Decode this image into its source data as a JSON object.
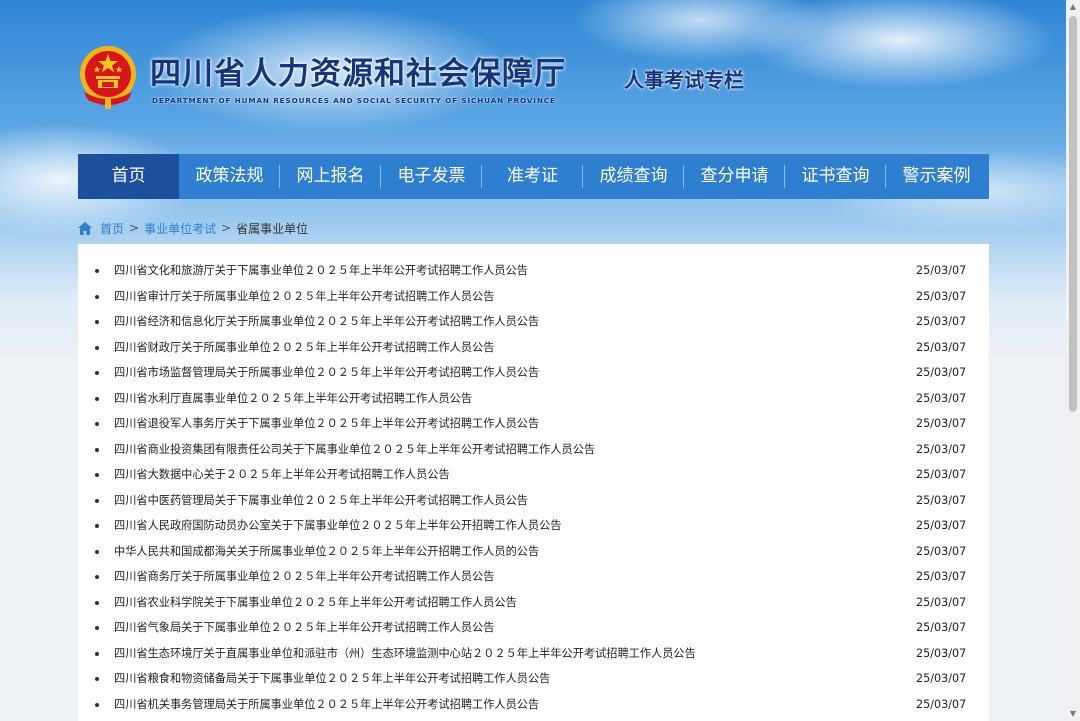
{
  "header": {
    "site_title": "四川省人力资源和社会保障厅",
    "site_subtitle": "DEPARTMENT OF HUMAN RESOURCES AND SOCIAL SECURITY OF SICHUAN PROVINCE",
    "column_name": "人事考试专栏",
    "emblem_icon": "national-emblem-icon"
  },
  "nav": {
    "items": [
      {
        "label": "首页",
        "active": true
      },
      {
        "label": "政策法规"
      },
      {
        "label": "网上报名"
      },
      {
        "label": "电子发票"
      },
      {
        "label": "准考证"
      },
      {
        "label": "成绩查询"
      },
      {
        "label": "查分申请"
      },
      {
        "label": "证书查询"
      },
      {
        "label": "警示案例"
      }
    ],
    "color": "#2f7fd1",
    "active_color": "#1c4f9c"
  },
  "breadcrumb": {
    "icon": "home-icon",
    "home": "首页",
    "section": "事业单位考试",
    "current": "省属事业单位",
    "separator": ">"
  },
  "news": [
    {
      "title": "四川省文化和旅游厅关于下属事业单位２０２５年上半年公开考试招聘工作人员公告",
      "date": "25/03/07"
    },
    {
      "title": "四川省审计厅关于所属事业单位２０２５年上半年公开考试招聘工作人员公告",
      "date": "25/03/07"
    },
    {
      "title": "四川省经济和信息化厅关于所属事业单位２０２５年上半年公开考试招聘工作人员公告",
      "date": "25/03/07"
    },
    {
      "title": "四川省财政厅关于所属事业单位２０２５年上半年公开考试招聘工作人员公告",
      "date": "25/03/07"
    },
    {
      "title": "四川省市场监督管理局关于所属事业单位２０２５年上半年公开考试招聘工作人员公告",
      "date": "25/03/07"
    },
    {
      "title": "四川省水利厅直属事业单位２０２５年上半年公开考试招聘工作人员公告",
      "date": "25/03/07"
    },
    {
      "title": "四川省退役军人事务厅关于下属事业单位２０２５年上半年公开考试招聘工作人员公告",
      "date": "25/03/07"
    },
    {
      "title": "四川省商业投资集团有限责任公司关于下属事业单位２０２５年上半年公开考试招聘工作人员公告",
      "date": "25/03/07"
    },
    {
      "title": "四川省大数据中心关于２０２５年上半年公开考试招聘工作人员公告",
      "date": "25/03/07"
    },
    {
      "title": "四川省中医药管理局关于下属事业单位２０２５年上半年公开考试招聘工作人员公告",
      "date": "25/03/07"
    },
    {
      "title": "四川省人民政府国防动员办公室关于下属事业单位２０２５年上半年公开招聘工作人员公告",
      "date": "25/03/07"
    },
    {
      "title": "中华人民共和国成都海关关于所属事业单位２０２５年上半年公开招聘工作人员的公告",
      "date": "25/03/07"
    },
    {
      "title": "四川省商务厅关于所属事业单位２０２５年上半年公开考试招聘工作人员公告",
      "date": "25/03/07"
    },
    {
      "title": "四川省农业科学院关于下属事业单位２０２５年上半年公开考试招聘工作人员公告",
      "date": "25/03/07"
    },
    {
      "title": "四川省气象局关于下属事业单位２０２５年上半年公开考试招聘工作人员公告",
      "date": "25/03/07"
    },
    {
      "title": "四川省生态环境厅关于直属事业单位和派驻市（州）生态环境监测中心站２０２５年上半年公开考试招聘工作人员公告",
      "date": "25/03/07"
    },
    {
      "title": "四川省粮食和物资储备局关于下属事业单位２０２５年上半年公开考试招聘工作人员公告",
      "date": "25/03/07"
    },
    {
      "title": "四川省机关事务管理局关于所属事业单位２０２５年上半年公开考试招聘工作人员公告",
      "date": "25/03/07"
    }
  ]
}
